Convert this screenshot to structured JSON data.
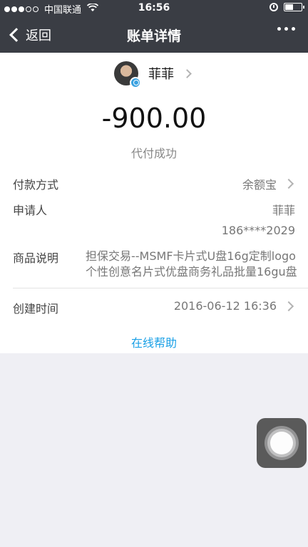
{
  "status_bar": {
    "carrier": "中国联通",
    "time": "16:56",
    "battery_level": 0.45
  },
  "nav": {
    "back_label": "返回",
    "title": "账单详情"
  },
  "payee": {
    "name": "菲菲"
  },
  "amount": "-900.00",
  "status": "代付成功",
  "details": {
    "payment_method_label": "付款方式",
    "payment_method_value": "余额宝",
    "applicant_label": "申请人",
    "applicant_name": "菲菲",
    "applicant_phone": "186****2029",
    "description_label": "商品说明",
    "description_value": "担保交易--MSMF卡片式U盘16g定制logo个性创意名片式优盘商务礼品批量16gu盘",
    "created_label": "创建时间",
    "created_value": "2016-06-12 16:36"
  },
  "help_link": "在线帮助",
  "icons": {
    "back": "chevron-left-icon",
    "more": "more-dots-icon",
    "row_chevron": "chevron-right-icon",
    "assistive": "assistive-touch-icon"
  },
  "colors": {
    "header": "#3a3d44",
    "link": "#1aa0e6",
    "background": "#efeff4"
  }
}
